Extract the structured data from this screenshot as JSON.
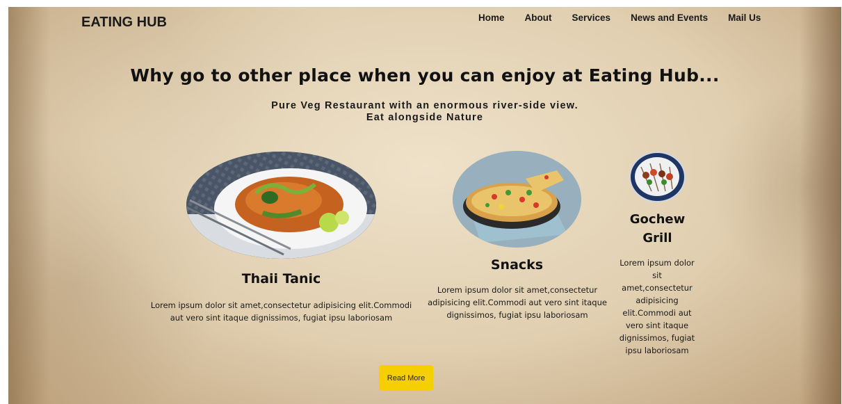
{
  "header": {
    "brand": "EATING HUB",
    "nav": [
      "Home",
      "About",
      "Services",
      "News and Events",
      "Mail Us"
    ]
  },
  "hero": {
    "title": "Why go to other place when you can enjoy at Eating Hub...",
    "subtitle_line1": "Pure Veg Restaurant with an enormous river-side view.",
    "subtitle_line2": "Eat alongside Nature"
  },
  "dishes": [
    {
      "title": "Thaii Tanic",
      "description": "Lorem ipsum dolor sit amet,consectetur adipisicing elit.Commodi aut vero sint itaque dignissimos, fugiat ipsu laboriosam"
    },
    {
      "title": "Snacks",
      "description": "Lorem ipsum dolor sit amet,consectetur adipisicing elit.Commodi aut vero sint itaque dignissimos, fugiat ipsu laboriosam"
    },
    {
      "title": "Gochew Grill",
      "description": "Lorem ipsum dolor sit amet,consectetur adipisicing elit.Commodi aut vero sint itaque dignissimos, fugiat ipsu laboriosam"
    }
  ],
  "cta": {
    "label": "Read More"
  },
  "colors": {
    "button": "#f5cf00",
    "text": "#111111",
    "parchment": "#dfccab"
  }
}
